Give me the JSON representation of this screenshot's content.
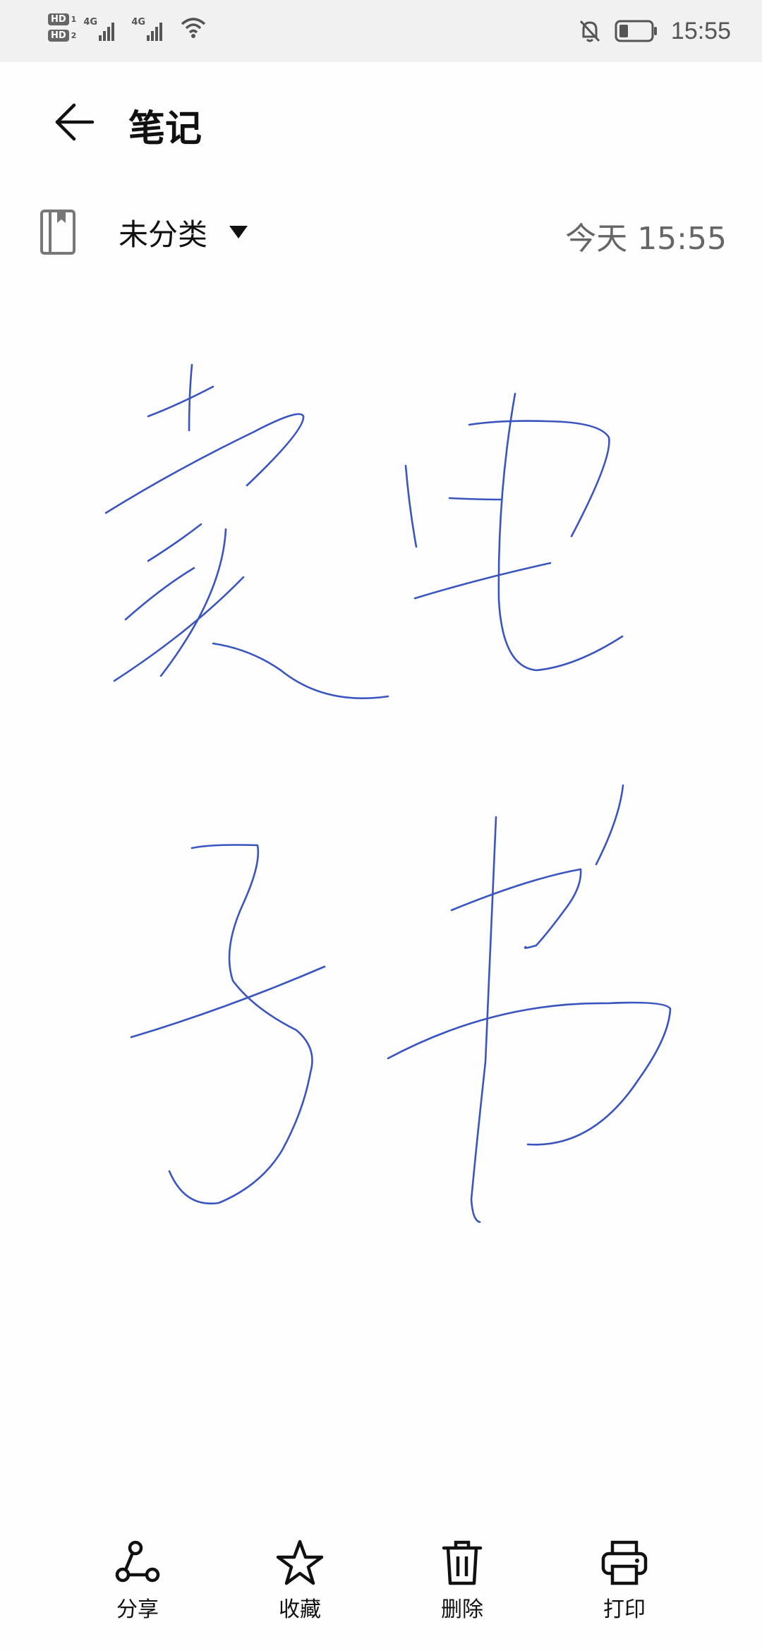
{
  "status_bar": {
    "sim1": "HD",
    "sim1_num": "1",
    "sim2": "HD",
    "sim2_num": "2",
    "net1": "4G",
    "net2": "4G",
    "time": "15:55",
    "icons": [
      "signal-icon",
      "wifi-icon",
      "bell-off-icon",
      "battery-icon"
    ]
  },
  "header": {
    "title": "笔记",
    "back_icon": "arrow-left-icon"
  },
  "meta": {
    "category": "未分类",
    "category_icon": "notebook-icon",
    "dropdown_icon": "triangle-down-icon",
    "timestamp": "今天 15:55"
  },
  "note": {
    "ink_color": "#3a55c0",
    "handwritten_text": "麦电子书"
  },
  "toolbar": {
    "actions": [
      {
        "label": "分享",
        "icon": "share-icon"
      },
      {
        "label": "收藏",
        "icon": "star-icon"
      },
      {
        "label": "删除",
        "icon": "trash-icon"
      },
      {
        "label": "打印",
        "icon": "printer-icon"
      }
    ]
  }
}
